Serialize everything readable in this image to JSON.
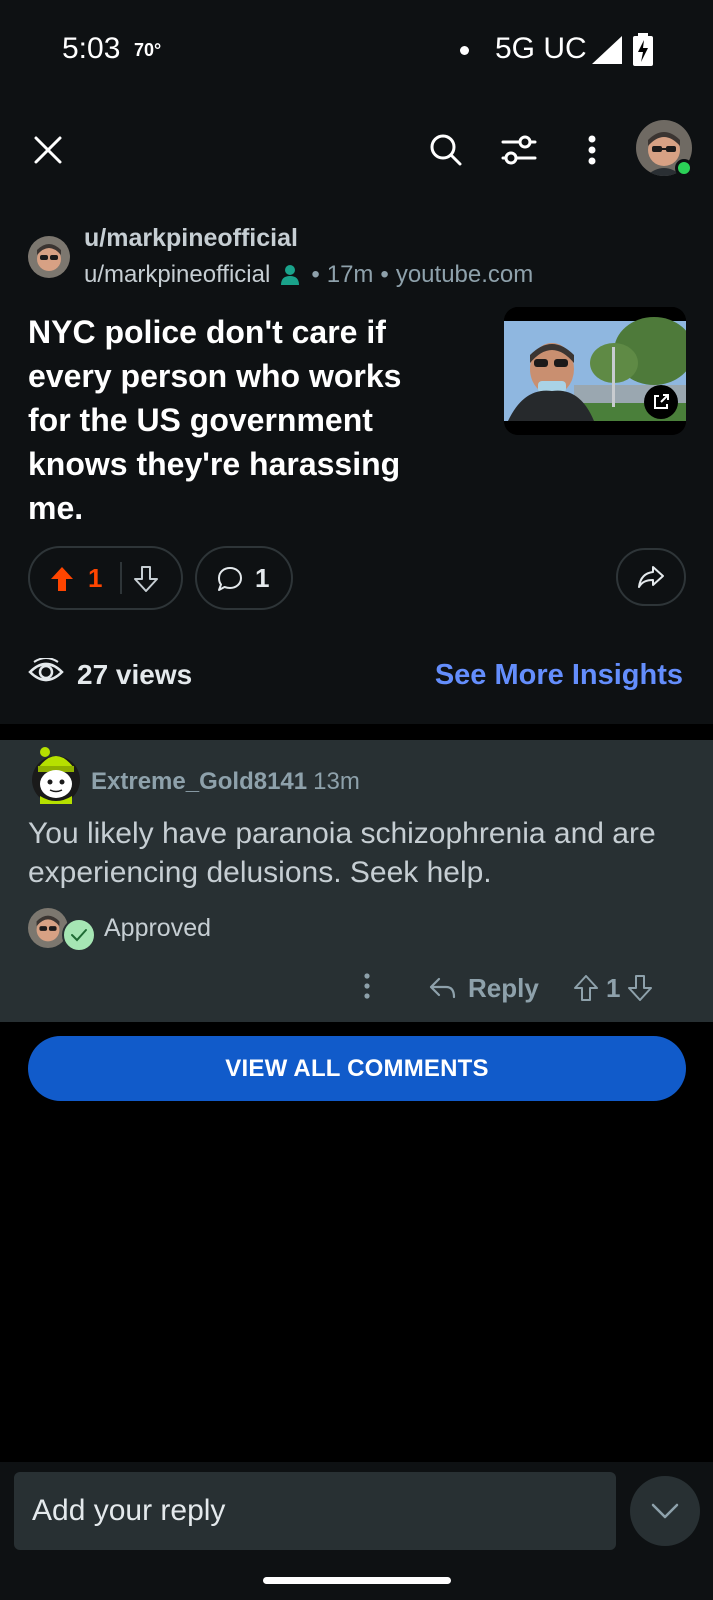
{
  "status_bar": {
    "time": "5:03",
    "temp": "70°",
    "network": "5G UC"
  },
  "post": {
    "subreddit": "u/markpineofficial",
    "author": "u/markpineofficial",
    "age": "17m",
    "domain": "youtube.com",
    "title": "NYC police don't care if every person who works for the US government knows they're harassing me.",
    "upvotes": "1",
    "comments": "1",
    "views": "27 views",
    "insights_link": "See More Insights"
  },
  "comment": {
    "username": "Extreme_Gold8141",
    "age": "13m",
    "body": "You likely have paranoia schizophrenia and are experiencing delusions. Seek help.",
    "approved_label": "Approved",
    "reply_label": "Reply",
    "score": "1"
  },
  "view_all_label": "VIEW ALL COMMENTS",
  "composer": {
    "placeholder": "Add your reply"
  },
  "colors": {
    "upvote": "#ff4500",
    "link": "#648efc",
    "primary_button": "#115bca",
    "online": "#2bd157"
  }
}
